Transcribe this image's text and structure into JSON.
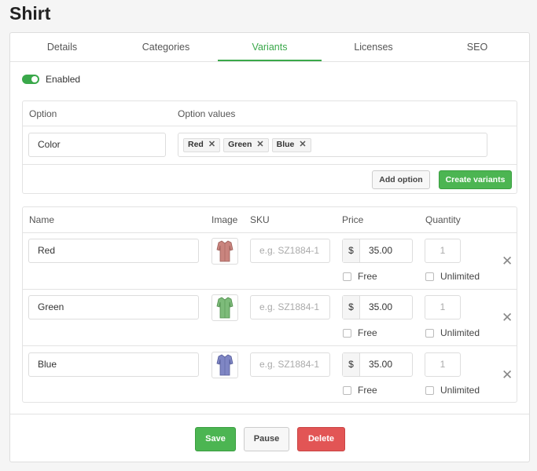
{
  "page": {
    "title": "Shirt"
  },
  "tabs": [
    {
      "label": "Details",
      "active": false
    },
    {
      "label": "Categories",
      "active": false
    },
    {
      "label": "Variants",
      "active": true
    },
    {
      "label": "Licenses",
      "active": false
    },
    {
      "label": "SEO",
      "active": false
    }
  ],
  "variants_toggle": {
    "label": "Enabled",
    "enabled": true
  },
  "options": {
    "headers": {
      "option": "Option",
      "values": "Option values"
    },
    "option_name": "Color",
    "values": [
      {
        "label": "Red",
        "remove": "✕"
      },
      {
        "label": "Green",
        "remove": "✕"
      },
      {
        "label": "Blue",
        "remove": "✕"
      }
    ],
    "add_option_label": "Add option",
    "create_variants_label": "Create variants"
  },
  "variants_table": {
    "headers": {
      "name": "Name",
      "image": "Image",
      "sku": "SKU",
      "price": "Price",
      "quantity": "Quantity"
    },
    "sku_placeholder": "e.g. SZ1884-1",
    "currency": "$",
    "free_label": "Free",
    "unlimited_label": "Unlimited",
    "remove_glyph": "✕",
    "rows": [
      {
        "name": "Red",
        "image_icon": "shirt-red-icon",
        "color": "#c9847e",
        "price": "35.00",
        "quantity": "1"
      },
      {
        "name": "Green",
        "image_icon": "shirt-green-icon",
        "color": "#7dbb7a",
        "price": "35.00",
        "quantity": "1"
      },
      {
        "name": "Blue",
        "image_icon": "shirt-blue-icon",
        "color": "#7f86c4",
        "price": "35.00",
        "quantity": "1"
      }
    ]
  },
  "actions": {
    "save": "Save",
    "pause": "Pause",
    "delete": "Delete"
  },
  "colors": {
    "accent": "#3aa84a",
    "danger": "#e25555"
  }
}
